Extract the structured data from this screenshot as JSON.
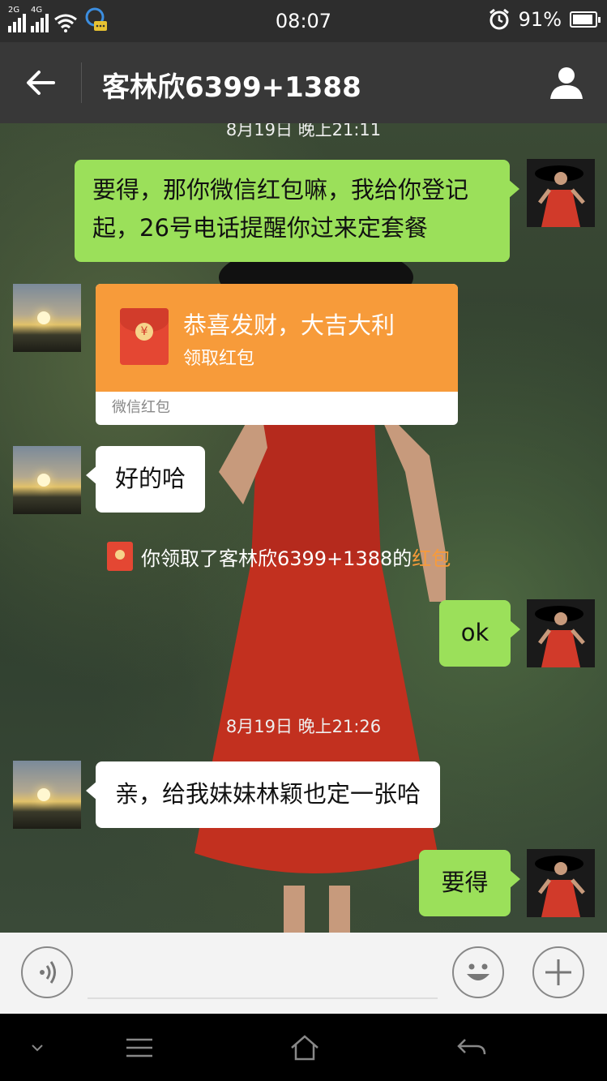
{
  "status_bar": {
    "signal1_label": "2G",
    "signal2_label": "4G",
    "time": "08:07",
    "battery_percent": "91%",
    "battery_level": 0.91
  },
  "header": {
    "title": "客林欣6399+1388"
  },
  "messages": {
    "ts_top_partial": "8月19日 晚上21:11",
    "msg1": "要得，那你微信红包嘛，我给你登记起，26号电话提醒你过来定套餐",
    "red_packet": {
      "title": "恭喜发财，大吉大利",
      "subtitle": "领取红包",
      "footer": "微信红包"
    },
    "msg2": "好的哈",
    "notice_prefix": "你领取了客林欣6399+1388的",
    "notice_link": "红包",
    "msg3": "ok",
    "ts2": "8月19日 晚上21:26",
    "msg4": "亲，给我妹妹林颖也定一张哈",
    "msg5": "要得"
  },
  "icons": {
    "back": "back-arrow-icon",
    "contact": "person-icon",
    "voice": "voice-icon",
    "emoji": "emoji-icon",
    "plus": "plus-icon",
    "nav": [
      "chevron-down-icon",
      "menu-icon",
      "home-icon",
      "return-icon"
    ]
  },
  "colors": {
    "green_bubble": "#9be05a",
    "red_packet_orange": "#f79b3a",
    "title_bar": "#383838"
  }
}
